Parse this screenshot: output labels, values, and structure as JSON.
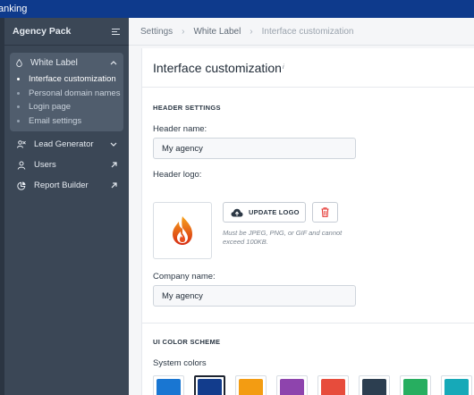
{
  "topbar": {
    "title": "anking"
  },
  "sidebar": {
    "header": "Agency Pack",
    "white_label": {
      "label": "White Label",
      "items": [
        {
          "label": "Interface customization"
        },
        {
          "label": "Personal domain names"
        },
        {
          "label": "Login page"
        },
        {
          "label": "Email settings"
        }
      ]
    },
    "nav": [
      {
        "label": "Lead Generator",
        "icon": "people-icon",
        "indicator": "chevron-down-icon"
      },
      {
        "label": "Users",
        "icon": "user-icon",
        "indicator": "external-arrow-icon"
      },
      {
        "label": "Report Builder",
        "icon": "pie-chart-icon",
        "indicator": "external-arrow-icon"
      }
    ]
  },
  "breadcrumb": {
    "items": [
      "Settings",
      "White Label",
      "Interface customization"
    ]
  },
  "page": {
    "title": "Interface customization",
    "info_mark": "i",
    "header_settings": {
      "section_title": "HEADER SETTINGS",
      "header_name_label": "Header name:",
      "header_name_value": "My agency",
      "header_logo_label": "Header logo:",
      "update_logo_button": "UPDATE LOGO",
      "logo_hint": "Must be JPEG, PNG, or GIF and cannot exceed 100KB.",
      "company_name_label": "Company name:",
      "company_name_value": "My agency"
    },
    "color_scheme": {
      "section_title": "UI COLOR SCHEME",
      "system_colors_label": "System colors",
      "colors": [
        "#1976d2",
        "#123c8c",
        "#f39c12",
        "#8e44ad",
        "#e74c3c",
        "#2c3e50",
        "#27ae60",
        "#16a9b8"
      ],
      "selected_index": 1
    }
  },
  "colors": {
    "topbar": "#0e3a8c",
    "sidebar": "#3b4756",
    "accent_delete": "#e53935",
    "logo_flame": "#e8501e"
  }
}
